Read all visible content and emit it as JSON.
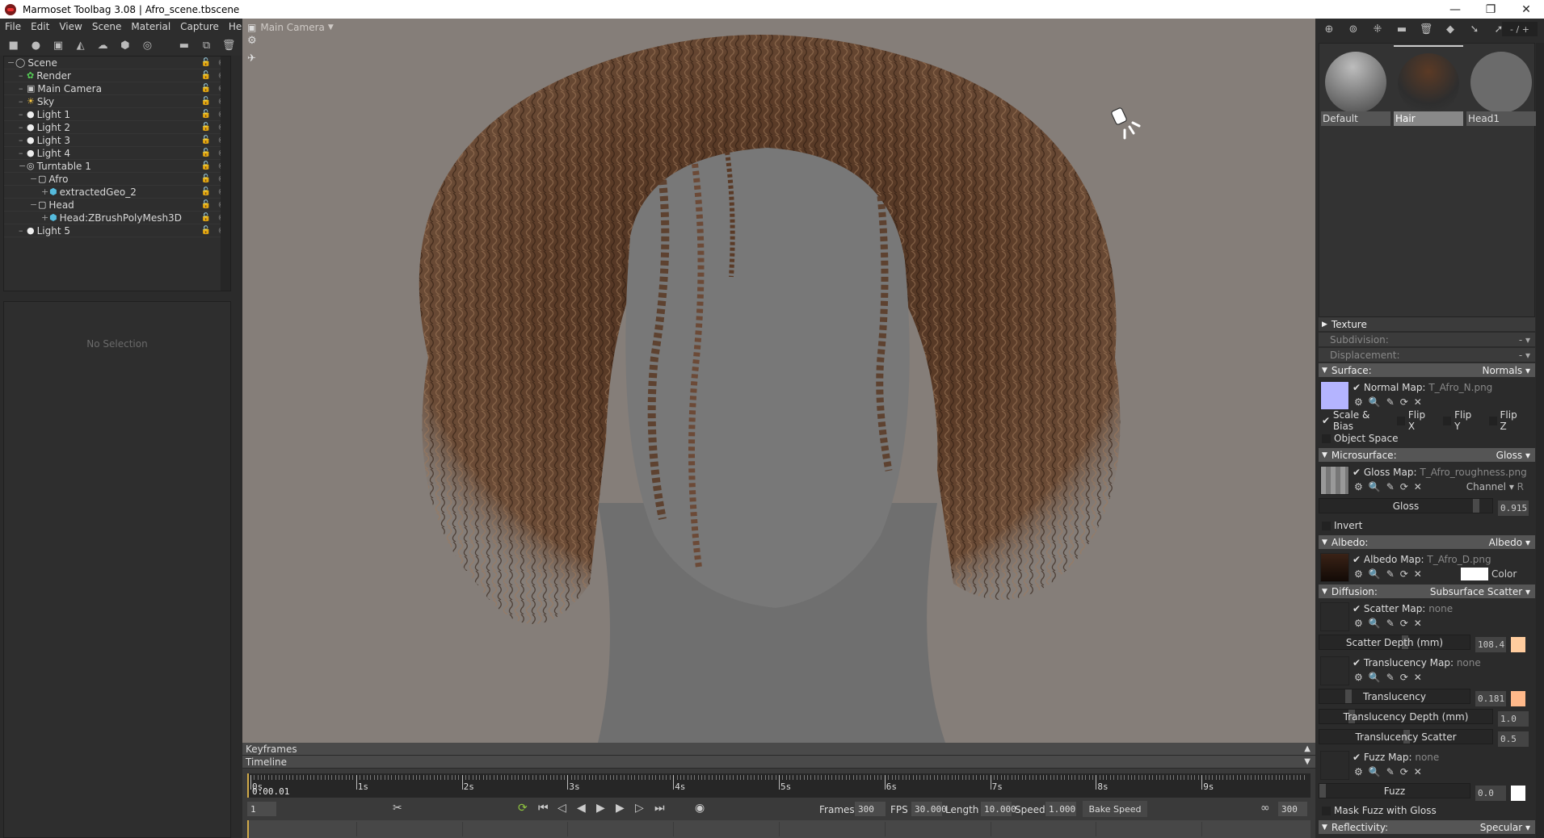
{
  "titlebar": {
    "title": "Marmoset Toolbag 3.08  |  Afro_scene.tbscene",
    "minimize": "—",
    "restore": "❐",
    "close": "✕"
  },
  "menu": [
    "File",
    "Edit",
    "View",
    "Scene",
    "Material",
    "Capture",
    "Help"
  ],
  "scene_toolbar_icons": [
    "mesh-icon",
    "light-icon",
    "camera-icon",
    "shadow-catcher-icon",
    "sky-icon",
    "turntable-icon",
    "audio-icon",
    "folder-icon",
    "duplicate-icon",
    "delete-icon"
  ],
  "outliner": {
    "items": [
      {
        "label": "Scene",
        "icon": "scene-icon",
        "depth": 0,
        "expander": "−"
      },
      {
        "label": "Render",
        "icon": "render-icon",
        "depth": 1
      },
      {
        "label": "Main Camera",
        "icon": "camera-icon",
        "depth": 1
      },
      {
        "label": "Sky",
        "icon": "sky-icon",
        "depth": 1
      },
      {
        "label": "Light 1",
        "icon": "light-icon",
        "depth": 1
      },
      {
        "label": "Light 2",
        "icon": "light-icon",
        "depth": 1
      },
      {
        "label": "Light 3",
        "icon": "light-icon",
        "depth": 1
      },
      {
        "label": "Light 4",
        "icon": "light-icon",
        "depth": 1
      },
      {
        "label": "Turntable 1",
        "icon": "turntable-icon",
        "depth": 1,
        "expander": "−"
      },
      {
        "label": "Afro",
        "icon": "group-icon",
        "depth": 2,
        "expander": "−"
      },
      {
        "label": "extractedGeo_2",
        "icon": "mesh-icon",
        "depth": 3,
        "expander": "+"
      },
      {
        "label": "Head",
        "icon": "group-icon",
        "depth": 2,
        "expander": "−"
      },
      {
        "label": "Head:ZBrushPolyMesh3D",
        "icon": "mesh-icon",
        "depth": 3,
        "expander": "+"
      },
      {
        "label": "Light 5",
        "icon": "light-icon",
        "depth": 1
      }
    ]
  },
  "properties_left": {
    "empty_text": "No Selection"
  },
  "viewport": {
    "camera_label": "Main Camera",
    "background": "#857e79"
  },
  "timeline": {
    "keyframes_label": "Keyframes",
    "timeline_label": "Timeline",
    "ticks": [
      "0s",
      "1s",
      "2s",
      "3s",
      "4s",
      "5s",
      "6s",
      "7s",
      "8s",
      "9s"
    ],
    "current_time": "0:00.01",
    "current_frame": "1",
    "frames_label": "Frames",
    "frames": "300",
    "fps_label": "FPS",
    "fps": "30.000",
    "length_label": "Length",
    "length": "10.000",
    "speed_label": "Speed",
    "speed": "1.000",
    "bake_speed": "Bake Speed",
    "end_frame": "300"
  },
  "materials": {
    "counter": "- / +",
    "items": [
      {
        "name": "Default",
        "selected": false
      },
      {
        "name": "Hair",
        "selected": true
      },
      {
        "name": "Head1",
        "selected": false
      }
    ]
  },
  "props": {
    "texture": "Texture",
    "subdivision": {
      "label": "Subdivision:",
      "value": "-"
    },
    "displacement": {
      "label": "Displacement:",
      "value": "-"
    },
    "surface": {
      "label": "Surface:",
      "value": "Normals",
      "map_label": "Normal Map:",
      "map_file": "T_Afro_N.png",
      "scale_bias": "Scale & Bias",
      "flip_x": "Flip X",
      "flip_y": "Flip Y",
      "flip_z": "Flip Z",
      "object_space": "Object Space"
    },
    "microsurface": {
      "label": "Microsurface:",
      "value": "Gloss",
      "map_label": "Gloss Map:",
      "map_file": "T_Afro_roughness.png",
      "channel_label": "Channel",
      "channel": "R",
      "gloss_label": "Gloss",
      "gloss": "0.915",
      "gloss_fraction": 0.915,
      "invert": "Invert"
    },
    "albedo": {
      "label": "Albedo:",
      "value": "Albedo",
      "map_label": "Albedo Map:",
      "map_file": "T_Afro_D.png",
      "color_label": "Color",
      "color": "#ffffff"
    },
    "diffusion": {
      "label": "Diffusion:",
      "value": "Subsurface Scatter",
      "scatter_map_label": "Scatter Map:",
      "scatter_map_file": "none",
      "scatter_depth_label": "Scatter Depth (mm)",
      "scatter_depth": "108.4",
      "scatter_color": "#ffcc9e",
      "translucency_map_label": "Translucency Map:",
      "translucency_map_file": "none",
      "translucency_label": "Translucency",
      "translucency": "0.181",
      "translucency_color": "#ffb98a",
      "translucency_depth_label": "Translucency Depth (mm)",
      "translucency_depth": "1.0",
      "translucency_scatter_label": "Translucency Scatter",
      "translucency_scatter": "0.5",
      "fuzz_map_label": "Fuzz Map:",
      "fuzz_map_file": "none",
      "fuzz_label": "Fuzz",
      "fuzz": "0.0",
      "fuzz_color": "#ffffff",
      "mask_fuzz": "Mask Fuzz with Gloss"
    },
    "reflectivity": {
      "label": "Reflectivity:",
      "value": "Specular"
    }
  }
}
